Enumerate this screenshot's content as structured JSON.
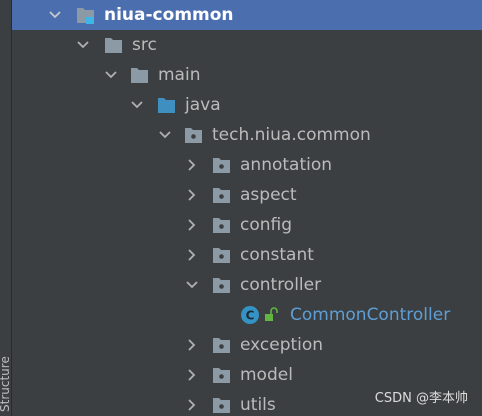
{
  "side_panel": {
    "label": "Structure"
  },
  "tree": [
    {
      "label": "niua-common",
      "state": "expanded",
      "icon": "module-folder-icon",
      "selected": true
    },
    {
      "label": "src",
      "state": "expanded",
      "icon": "folder-icon"
    },
    {
      "label": "main",
      "state": "expanded",
      "icon": "folder-icon"
    },
    {
      "label": "java",
      "state": "expanded",
      "icon": "source-root-folder-icon"
    },
    {
      "label": "tech.niua.common",
      "state": "expanded",
      "icon": "package-icon"
    },
    {
      "label": "annotation",
      "state": "collapsed",
      "icon": "package-icon"
    },
    {
      "label": "aspect",
      "state": "collapsed",
      "icon": "package-icon"
    },
    {
      "label": "config",
      "state": "collapsed",
      "icon": "package-icon"
    },
    {
      "label": "constant",
      "state": "collapsed",
      "icon": "package-icon"
    },
    {
      "label": "controller",
      "state": "expanded",
      "icon": "package-icon"
    },
    {
      "label": "CommonController",
      "state": "leaf",
      "icon": "class-icon"
    },
    {
      "label": "exception",
      "state": "collapsed",
      "icon": "package-icon"
    },
    {
      "label": "model",
      "state": "collapsed",
      "icon": "package-icon"
    },
    {
      "label": "utils",
      "state": "collapsed",
      "icon": "package-icon"
    }
  ],
  "watermark": "CSDN @李本帅",
  "colors": {
    "background": "#3c3f41",
    "selection": "#4b6eaf",
    "text": "#bbbbbb",
    "folder": "#8c9aa5",
    "source_root": "#3f8fc1",
    "class_badge": "#3592c4",
    "class_text": "#5f9ed4",
    "lock": "#62b543"
  }
}
